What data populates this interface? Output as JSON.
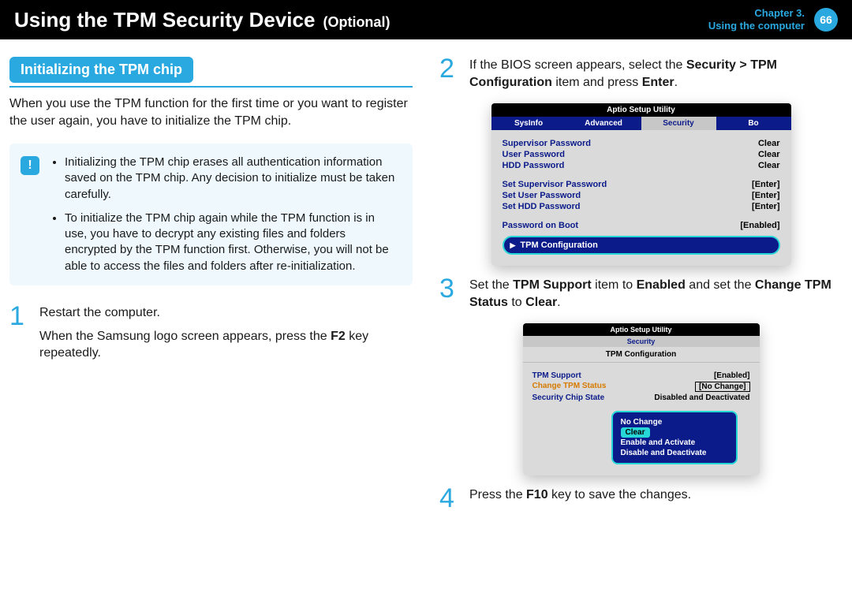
{
  "header": {
    "title": "Using the TPM Security Device",
    "optional": "(Optional)",
    "chapter_line": "Chapter 3.",
    "section_line": "Using the computer",
    "page_number": "66"
  },
  "section": {
    "title": "Initializing the TPM chip",
    "intro": "When you use the TPM function for the first time or you want to register the user again, you have to initialize the TPM chip."
  },
  "note": {
    "icon": "!",
    "bullets": [
      "Initializing the TPM chip erases all authentication information saved on the TPM chip. Any decision to initialize must be taken carefully.",
      "To initialize the TPM chip again while the TPM function is in use, you have to decrypt any existing files and folders encrypted by the TPM function first. Otherwise, you will not be able to access the files and folders after re-initialization."
    ]
  },
  "steps": {
    "1": {
      "num": "1",
      "p1": "Restart the computer.",
      "p2_pre": "When the Samsung logo screen appears, press the ",
      "p2_key": "F2",
      "p2_post": " key repeatedly."
    },
    "2": {
      "num": "2",
      "pre": "If the BIOS screen appears, select the ",
      "b1": "Security > TPM Configuration",
      "mid": " item and press ",
      "b2": "Enter",
      "post": "."
    },
    "3": {
      "num": "3",
      "pre": "Set the ",
      "b1": "TPM Support",
      "mid1": " item to ",
      "b2": "Enabled",
      "mid2": " and set the ",
      "b3": "Change TPM Status",
      "mid3": " to ",
      "b4": "Clear",
      "post": "."
    },
    "4": {
      "num": "4",
      "pre": "Press the ",
      "b1": "F10",
      "post": " key to save the changes."
    }
  },
  "bios1": {
    "title": "Aptio Setup Utility",
    "tabs": [
      "SysInfo",
      "Advanced",
      "Security",
      "Bo"
    ],
    "rows": [
      {
        "label": "Supervisor Password",
        "value": "Clear"
      },
      {
        "label": "User Password",
        "value": "Clear"
      },
      {
        "label": "HDD Password",
        "value": "Clear"
      }
    ],
    "rows2": [
      {
        "label": "Set Supervisor Password",
        "value": "[Enter]"
      },
      {
        "label": "Set User Password",
        "value": "[Enter]"
      },
      {
        "label": "Set HDD Password",
        "value": "[Enter]"
      }
    ],
    "rows3": [
      {
        "label": "Password on Boot",
        "value": "[Enabled]"
      }
    ],
    "highlight": "TPM Configuration"
  },
  "bios2": {
    "title": "Aptio Setup Utility",
    "tab": "Security",
    "subtitle": "TPM Configuration",
    "rows": [
      {
        "label": "TPM Support",
        "value": "[Enabled]",
        "style": ""
      },
      {
        "label": "Change TPM Status",
        "value": "[No Change]",
        "style": "orange boxed"
      },
      {
        "label": "Security Chip State",
        "value": "Disabled and Deactivated",
        "style": ""
      }
    ],
    "popup": [
      "No Change",
      "Clear",
      "Enable and Activate",
      "Disable and Deactivate"
    ],
    "popup_selected": "Clear"
  }
}
